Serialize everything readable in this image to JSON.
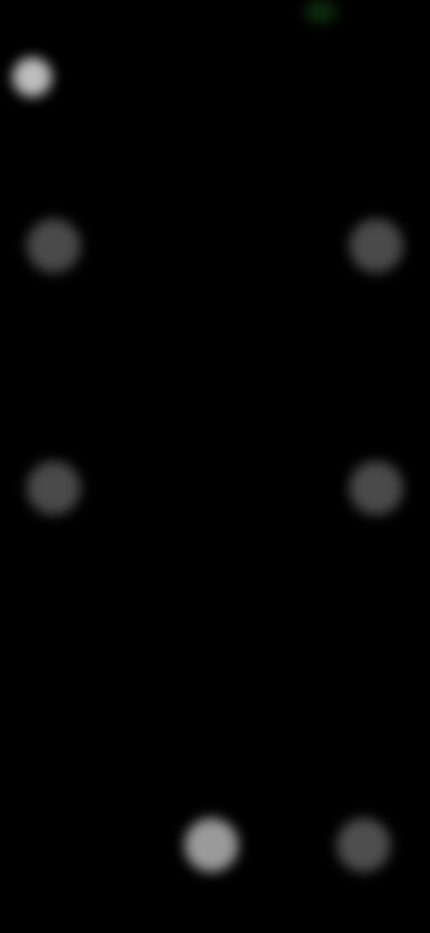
{
  "status_bar": {
    "time": "",
    "colors": {
      "time": "#8a8373",
      "indicator": "#0d2a0d"
    }
  },
  "top_bar": {
    "back_icon": "chevron-left-icon",
    "title": ""
  },
  "viewfinder": {
    "corner_icons": [
      "corner-top-left-icon",
      "corner-top-right-icon",
      "corner-bottom-left-icon",
      "corner-bottom-right-icon"
    ]
  },
  "bottom_controls": {
    "items": [
      {
        "label": "",
        "icon": "flash-icon"
      },
      {
        "label": "",
        "icon": "gallery-icon"
      }
    ]
  },
  "colors": {
    "background": "#000000",
    "icon_bright": "#bdbdbd",
    "icon_dim": "#4a4a4a"
  }
}
